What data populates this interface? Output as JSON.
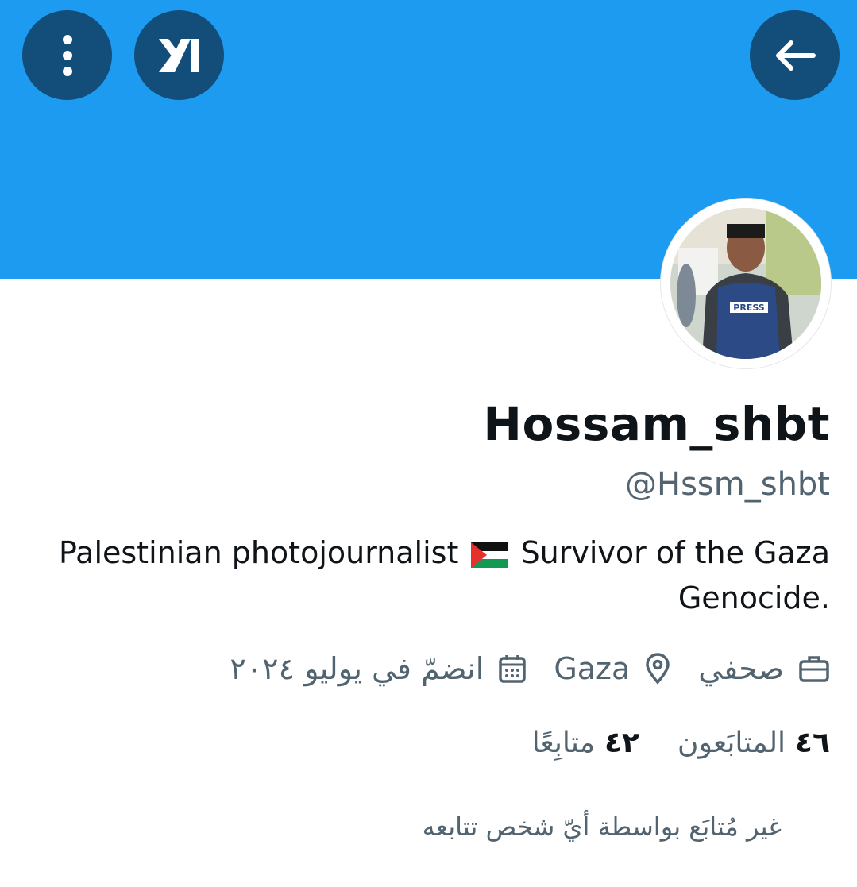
{
  "header": {
    "more_icon": "more-vertical-icon",
    "grok_icon": "grok-logo-icon",
    "back_icon": "arrow-back-icon"
  },
  "profile": {
    "display_name": "Hossam_shbt",
    "handle": "@Hssm_shbt",
    "bio_part1": "Palestinian photojournalist",
    "bio_part2": "Survivor of the Gaza Genocide.",
    "avatar_badge": "PRESS"
  },
  "meta": {
    "profession": "صحفي",
    "location": "Gaza",
    "joined": "انضمّ في يوليو ٢٠٢٤"
  },
  "stats": {
    "followers_count": "٤٦",
    "followers_label": "المتابَعون",
    "following_count": "٤٢",
    "following_label": "متابِعًا"
  },
  "note": "غير مُتابَع بواسطة أيّ شخص تتابعه",
  "colors": {
    "banner": "#1d9bf0",
    "button_bg": "#134d7a",
    "secondary_text": "#536471"
  }
}
